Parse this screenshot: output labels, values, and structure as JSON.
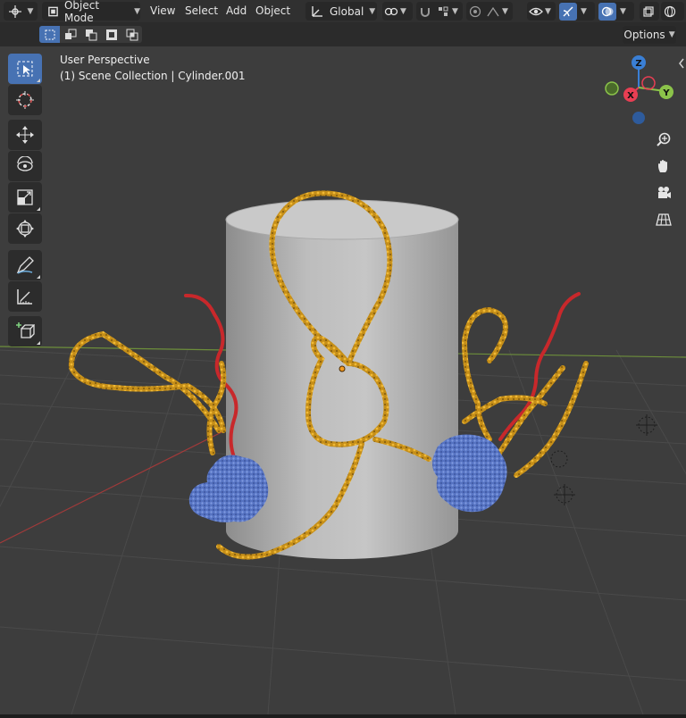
{
  "header": {
    "mode": "Object Mode",
    "menus": [
      "View",
      "Select",
      "Add",
      "Object"
    ],
    "orientation": "Global"
  },
  "subbar": {
    "options_label": "Options"
  },
  "viewport": {
    "perspective": "User Perspective",
    "collection": "(1) Scene Collection | Cylinder.001"
  },
  "gizmo": {
    "z_label": "Z",
    "x_label": "X",
    "y_label": "Y",
    "x_color": "#e83e53",
    "y_color": "#8bc34a",
    "z_color": "#3a7fd5"
  },
  "icons": {
    "editor_type": "axes-cursor-icon",
    "select": "select-box-icon",
    "cursor": "cursor-icon",
    "move": "move-icon",
    "rotate": "rotate-icon",
    "scale": "scale-icon",
    "transform": "transform-icon",
    "annotate": "annotate-icon",
    "measure": "measure-icon",
    "add_cube": "add-cube-icon",
    "zoom": "zoom-icon",
    "pan": "hand-icon",
    "camera": "camera-icon",
    "ortho": "grid-ortho-icon"
  },
  "colors": {
    "accent": "#4772b3",
    "viewport_bg": "#3d3d3d",
    "dna_gold": "#d9a022",
    "dna_red": "#c8282b",
    "protein_blue": "#5b7ccc"
  }
}
